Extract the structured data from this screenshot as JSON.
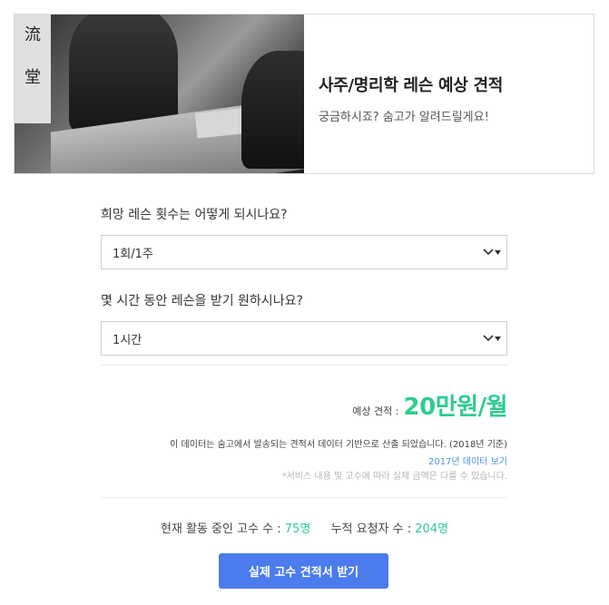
{
  "hero": {
    "title": "사주/명리학 레슨 예상 견적",
    "subtitle": "궁금하시죠? 숨고가 알려드릴게요!",
    "image_sign_text": "流\n\n堂"
  },
  "form": {
    "q1": {
      "label": "희망 레슨 횟수는 어떻게 되시나요?",
      "selected": "1회/1주"
    },
    "q2": {
      "label": "몇 시간 동안 레슨을 받기 원하시나요?",
      "selected": "1시간"
    },
    "chevron_icon": "chevron-down-icon",
    "arrow_icon": "triangle-down-icon"
  },
  "estimate": {
    "label": "예상 견적 :",
    "value": "20만원/월"
  },
  "info": {
    "line1": "이 데이터는 숨고에서 발송되는 견적서 데이터 기반으로 산출 되었습니다. (2018년 기준)",
    "link": "2017년 데이터 보기",
    "note": "*서비스 내용 및 고수에 따라 실제 금액은 다를 수 있습니다."
  },
  "stats": {
    "active_label": "현재 활동 중인 고수 수 :",
    "active_count": "75명",
    "requests_label": "누적 요청자 수 :",
    "requests_count": "204명"
  },
  "cta": {
    "label": "실제 고수 견적서 받기"
  },
  "colors": {
    "accent_green": "#2ecc8f",
    "button_blue": "#4b7bec",
    "link_blue": "#4a90e2"
  }
}
